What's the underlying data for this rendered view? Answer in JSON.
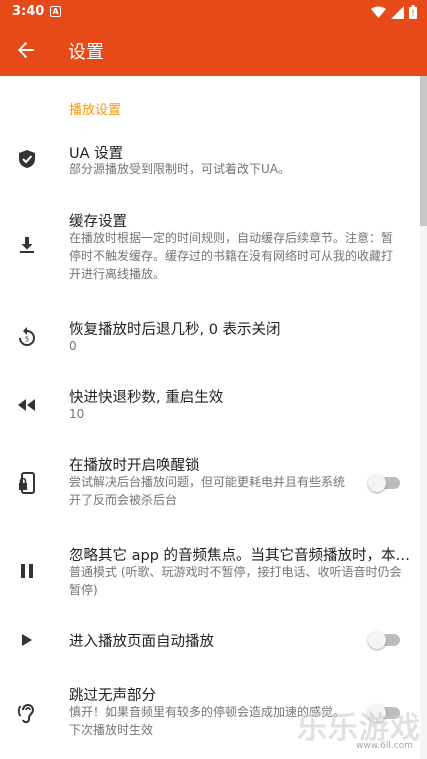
{
  "status_bar": {
    "time": "3:40",
    "notification_letter": "A"
  },
  "app_bar": {
    "title": "设置"
  },
  "section": {
    "title": "播放设置"
  },
  "prefs": [
    {
      "title": "UA 设置",
      "summary": "部分源播放受到限制时，可试着改下UA。"
    },
    {
      "title": "缓存设置",
      "summary": "在播放时根据一定的时间规则，自动缓存后续章节。注意：暂停时不触发缓存。缓存过的书籍在没有网络时可从我的收藏打开进行离线播放。"
    },
    {
      "title": "恢复播放时后退几秒, 0 表示关闭",
      "summary": "0"
    },
    {
      "title": "快进快退秒数, 重启生效",
      "summary": "10"
    },
    {
      "title": "在播放时开启唤醒锁",
      "summary": "尝试解决后台播放问题，但可能更耗电并且有些系统开了反而会被杀后台",
      "switch_on": false
    },
    {
      "title": "忽略其它 app 的音频焦点。当其它音频播放时，本应用会继续播放",
      "summary": "普通模式 (听歌、玩游戏时不暂停，接打电话、收听语音时仍会暂停)"
    },
    {
      "title": "进入播放页面自动播放",
      "summary": "",
      "switch_on": false
    },
    {
      "title": "跳过无声部分",
      "summary": "慎开！如果音频里有较多的停顿会造成加速的感觉。下次播放时生效",
      "switch_on": false
    }
  ],
  "watermark": {
    "text": "乐乐游戏",
    "url": "www.6ll.com"
  },
  "colors": {
    "primary": "#e64a19",
    "accent": "#ff9800"
  }
}
